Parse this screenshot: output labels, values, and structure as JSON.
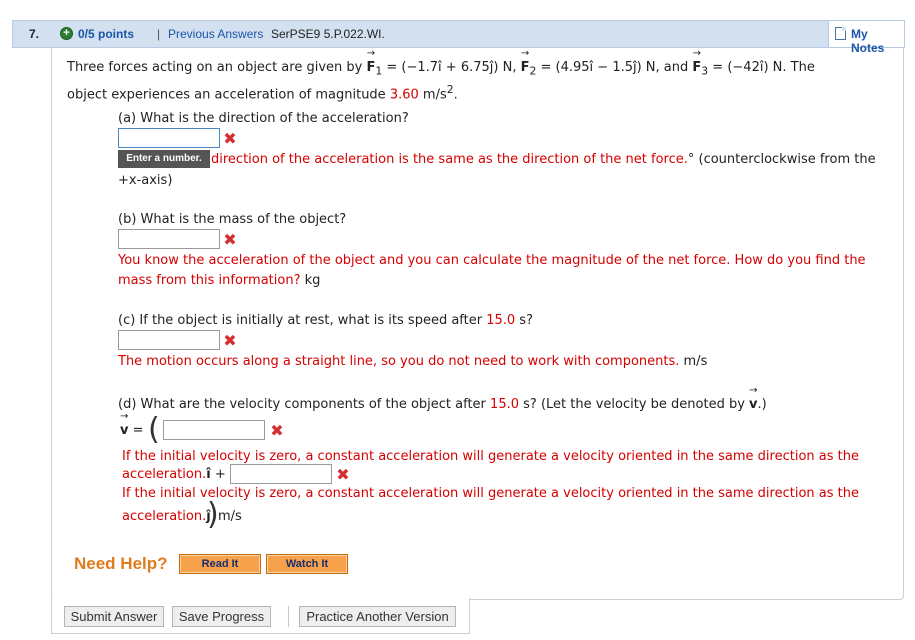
{
  "header": {
    "question_number": "7.",
    "plus_symbol": "+",
    "points": "0/5 points",
    "separator": "|",
    "previous_answers": "Previous Answers",
    "assignment_code": "SerPSE9 5.P.022.WI.",
    "my_notes": "My Notes"
  },
  "problem": {
    "p1_a": "Three forces acting on an object are given by ",
    "F1_letter": "F",
    "F1_sub": "1",
    "F1_expr": " = (−1.7î + 6.75ĵ) N,  ",
    "F2_letter": "F",
    "F2_sub": "2",
    "F2_expr": " = (4.95î − 1.5ĵ) N,  and  ",
    "F3_letter": "F",
    "F3_sub": "3",
    "F3_expr": " = (−42î) N.  The",
    "p2_a": "object experiences an acceleration of magnitude ",
    "accel_value": "3.60",
    "accel_unit": " m/s",
    "accel_exp": "2",
    "p2_end": "."
  },
  "part_a": {
    "question": "(a) What is the direction of the acceleration?",
    "tooltip": "Enter a number.",
    "feedback": "direction of the acceleration is the same as the direction of the net force.",
    "unit": "° (counterclockwise from the",
    "unit_line2": "+x-axis)"
  },
  "part_b": {
    "question": "(b) What is the mass of the object?",
    "feedback_line1": "You know the acceleration of the object and you can calculate the magnitude of the net force. How do you find the",
    "feedback_line2": "mass from this information?",
    "unit": " kg"
  },
  "part_c": {
    "question_a": "(c) If the object is initially at rest, what is its speed after ",
    "time_value": "15.0",
    "question_b": " s?",
    "feedback": "The motion occurs along a straight line, so you do not need to work with components.",
    "unit": " m/s"
  },
  "part_d": {
    "question_a": "(d) What are the velocity components of the object after ",
    "time_value": "15.0",
    "question_b": " s? (Let the velocity be denoted by ",
    "v_letter": "v",
    "question_c": ".)",
    "v_eq": " =",
    "open_paren": "(",
    "close_paren": ")",
    "feedback_line1": "If the initial velocity is zero, a constant acceleration will generate a velocity oriented in the same direction as the",
    "feedback_line2": "acceleration.",
    "i_hat": "î",
    "plus": " +",
    "feedback_line3": "If the initial velocity is zero, a constant acceleration will generate a velocity oriented in the same direction as the",
    "feedback_line4": "acceleration.",
    "j_hat": "ĵ",
    "unit": " m/s"
  },
  "help": {
    "label": "Need Help?",
    "read_it": "Read It",
    "watch_it": "Watch It"
  },
  "actions": {
    "submit": "Submit Answer",
    "save": "Save Progress",
    "practice": "Practice Another Version"
  },
  "colors": {
    "link_blue": "#1a56a8",
    "error_red": "#d50000",
    "help_orange": "#e07b1e",
    "header_bg": "#d3e0f0"
  }
}
